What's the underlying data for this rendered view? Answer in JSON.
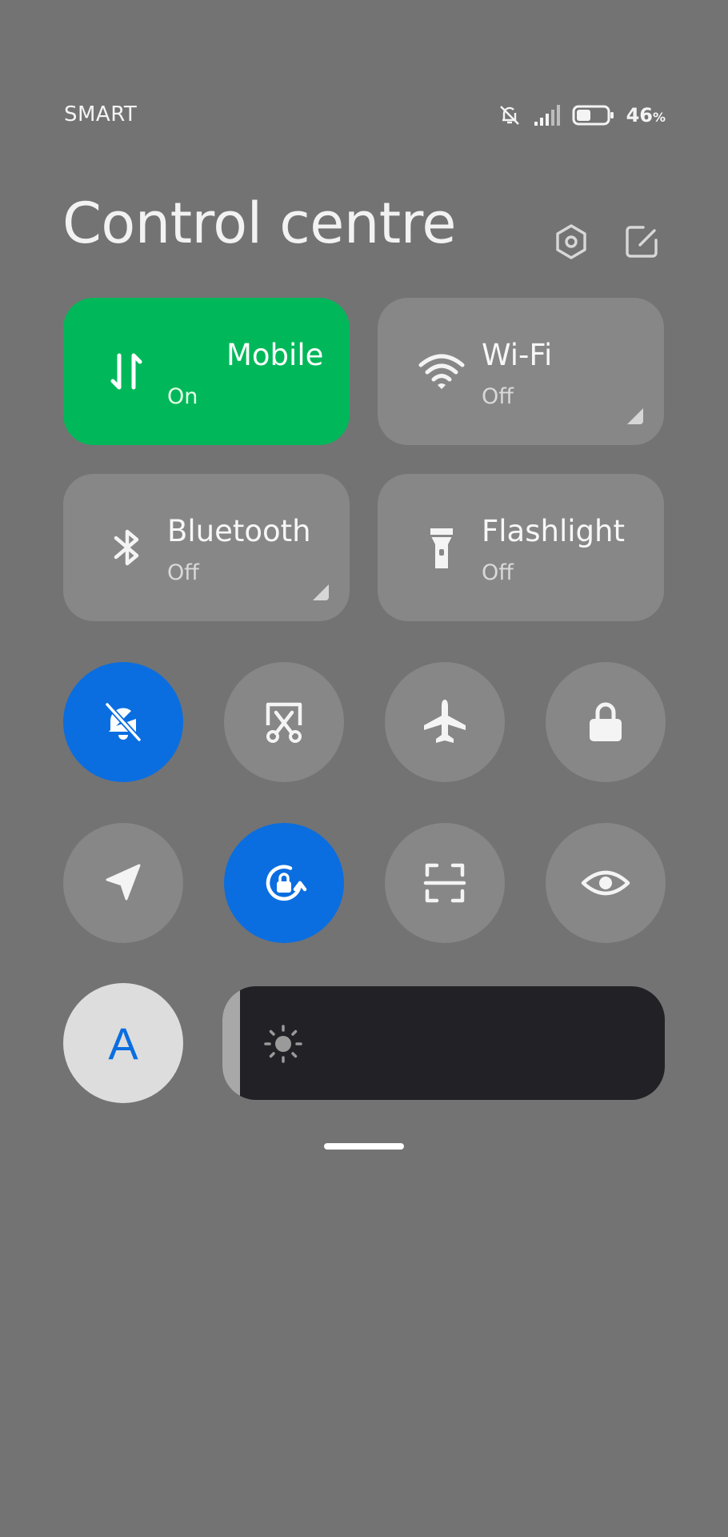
{
  "status_bar": {
    "carrier": "SMART",
    "battery_percent": "46",
    "battery_unit": "%",
    "battery_level": 0.46,
    "signal_level": 0.6
  },
  "header": {
    "title": "Control centre",
    "settings_icon": "hexagon-gear-icon",
    "edit_icon": "edit-icon"
  },
  "tiles": [
    {
      "id": "mobile",
      "label": "Mobile",
      "state": "On",
      "active": true,
      "icon": "mobile-data-icon"
    },
    {
      "id": "wifi",
      "label": "Wi-Fi",
      "state": "Off",
      "active": false,
      "icon": "wifi-icon"
    },
    {
      "id": "bluetooth",
      "label": "Bluetooth",
      "state": "Off",
      "active": false,
      "icon": "bluetooth-icon"
    },
    {
      "id": "flashlight",
      "label": "Flashlight",
      "state": "Off",
      "active": false,
      "icon": "flashlight-icon"
    }
  ],
  "toggles": [
    {
      "id": "silent",
      "icon": "bell-off-icon",
      "active": true
    },
    {
      "id": "screenshot",
      "icon": "scissors-screenshot-icon",
      "active": false
    },
    {
      "id": "airplane",
      "icon": "airplane-icon",
      "active": false
    },
    {
      "id": "lock",
      "icon": "lock-icon",
      "active": false
    },
    {
      "id": "location",
      "icon": "location-arrow-icon",
      "active": false
    },
    {
      "id": "rotation-lock",
      "icon": "rotation-lock-icon",
      "active": true
    },
    {
      "id": "scanner",
      "icon": "scan-frame-icon",
      "active": false
    },
    {
      "id": "reading-mode",
      "icon": "eye-icon",
      "active": false
    }
  ],
  "auto_brightness": {
    "letter": "A",
    "icon": "auto-brightness-icon"
  },
  "brightness": {
    "level": 0.04,
    "icon": "sun-icon"
  },
  "colors": {
    "background": "#737373",
    "tile": "#878787",
    "active_green": "#00b85a",
    "active_blue": "#0a6ee0",
    "slider_track": "#222226"
  }
}
